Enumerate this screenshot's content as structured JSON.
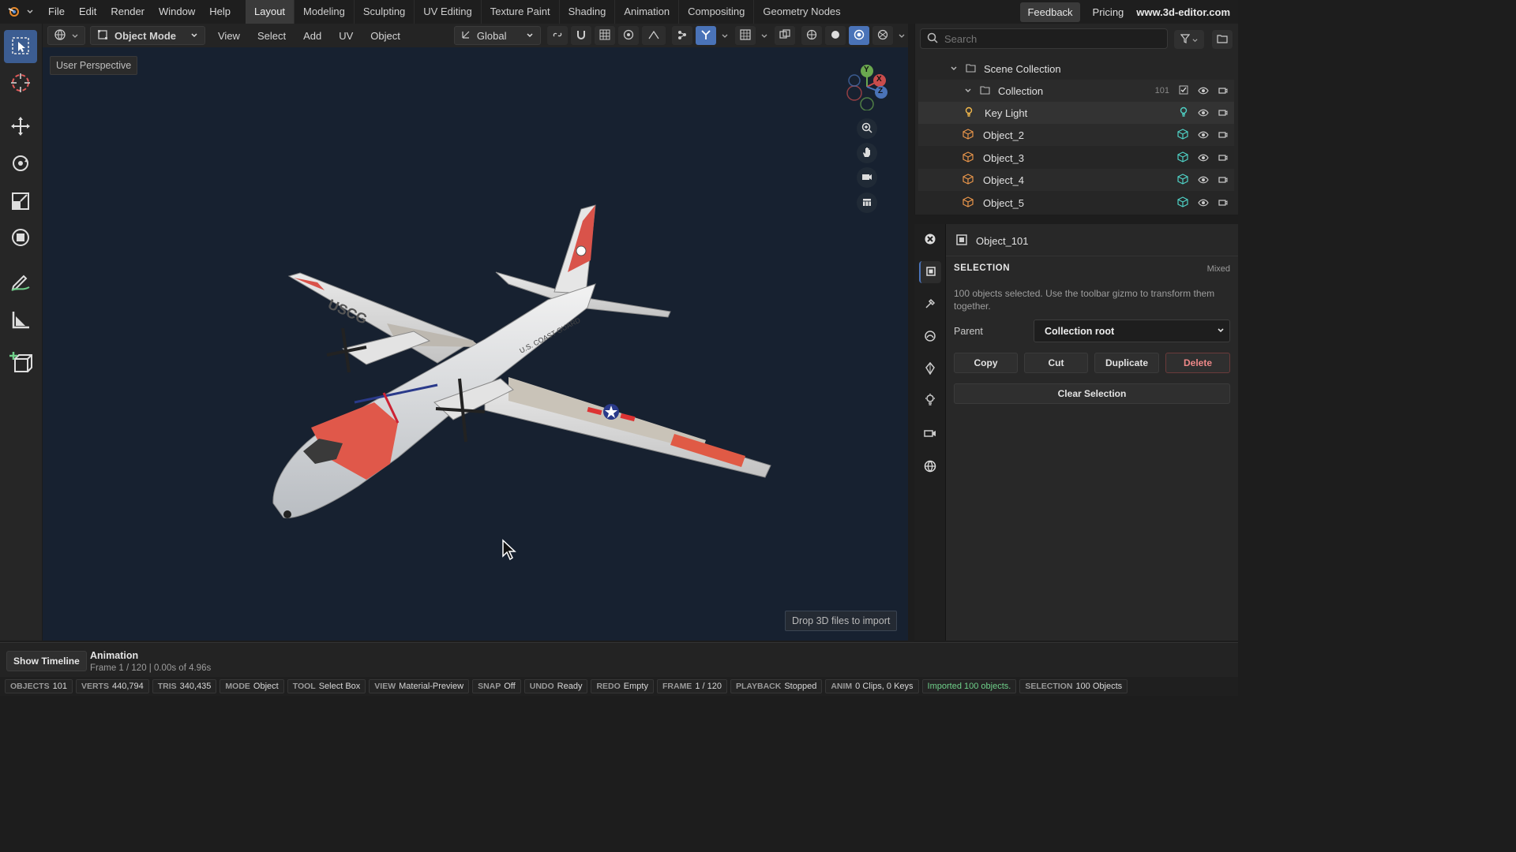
{
  "menu": {
    "items": [
      "File",
      "Edit",
      "Render",
      "Window",
      "Help"
    ]
  },
  "workspaces": [
    "Layout",
    "Modeling",
    "Sculpting",
    "UV Editing",
    "Texture Paint",
    "Shading",
    "Animation",
    "Compositing",
    "Geometry Nodes"
  ],
  "active_workspace": "Layout",
  "topright": {
    "feedback": "Feedback",
    "pricing": "Pricing",
    "site": "www.3d-editor.com"
  },
  "viewport_header": {
    "mode": "Object Mode",
    "menus": [
      "View",
      "Select",
      "Add",
      "UV",
      "Object"
    ],
    "orientation": "Global"
  },
  "viewport": {
    "perspective_label": "User Perspective",
    "drop_hint": "Drop 3D files to import",
    "gizmo": {
      "y": "Y",
      "x": "X",
      "z": "Z"
    },
    "aircraft_markings": {
      "wing": "USCG",
      "fuselage": "U.S. COAST GUARD"
    }
  },
  "outliner": {
    "search_placeholder": "Search",
    "scene_collection": "Scene Collection",
    "collection": {
      "label": "Collection",
      "count": "101"
    },
    "items": [
      {
        "label": "Key Light",
        "type": "light"
      },
      {
        "label": "Object_2",
        "type": "mesh"
      },
      {
        "label": "Object_3",
        "type": "mesh"
      },
      {
        "label": "Object_4",
        "type": "mesh"
      },
      {
        "label": "Object_5",
        "type": "mesh"
      }
    ]
  },
  "properties": {
    "object_name": "Object_101",
    "section_title": "SELECTION",
    "section_tag": "Mixed",
    "description": "100 objects selected. Use the toolbar gizmo to transform them together.",
    "parent_label": "Parent",
    "parent_value": "Collection root",
    "buttons": {
      "copy": "Copy",
      "cut": "Cut",
      "duplicate": "Duplicate",
      "delete": "Delete",
      "clear": "Clear Selection"
    }
  },
  "timeline": {
    "toggle": "Show Timeline",
    "title": "Animation",
    "info": "Frame 1 / 120 | 0.00s of 4.96s"
  },
  "status": [
    {
      "k": "OBJECTS",
      "v": "101"
    },
    {
      "k": "VERTS",
      "v": "440,794"
    },
    {
      "k": "TRIS",
      "v": "340,435"
    },
    {
      "k": "MODE",
      "v": "Object"
    },
    {
      "k": "TOOL",
      "v": "Select Box"
    },
    {
      "k": "VIEW",
      "v": "Material-Preview"
    },
    {
      "k": "SNAP",
      "v": "Off"
    },
    {
      "k": "UNDO",
      "v": "Ready"
    },
    {
      "k": "REDO",
      "v": "Empty"
    },
    {
      "k": "FRAME",
      "v": "1 / 120"
    },
    {
      "k": "PLAYBACK",
      "v": "Stopped"
    },
    {
      "k": "ANIM",
      "v": "0 Clips, 0 Keys"
    }
  ],
  "status_message": "Imported 100 objects.",
  "status_selection": {
    "k": "SELECTION",
    "v": "100 Objects"
  },
  "colors": {
    "accent": "#4a73b8",
    "viewport_bg": "#172130",
    "delete": "#e06a6a",
    "ok": "#6fd08a",
    "mesh_icon": "#e8954a",
    "light_icon": "#f2b84b"
  }
}
